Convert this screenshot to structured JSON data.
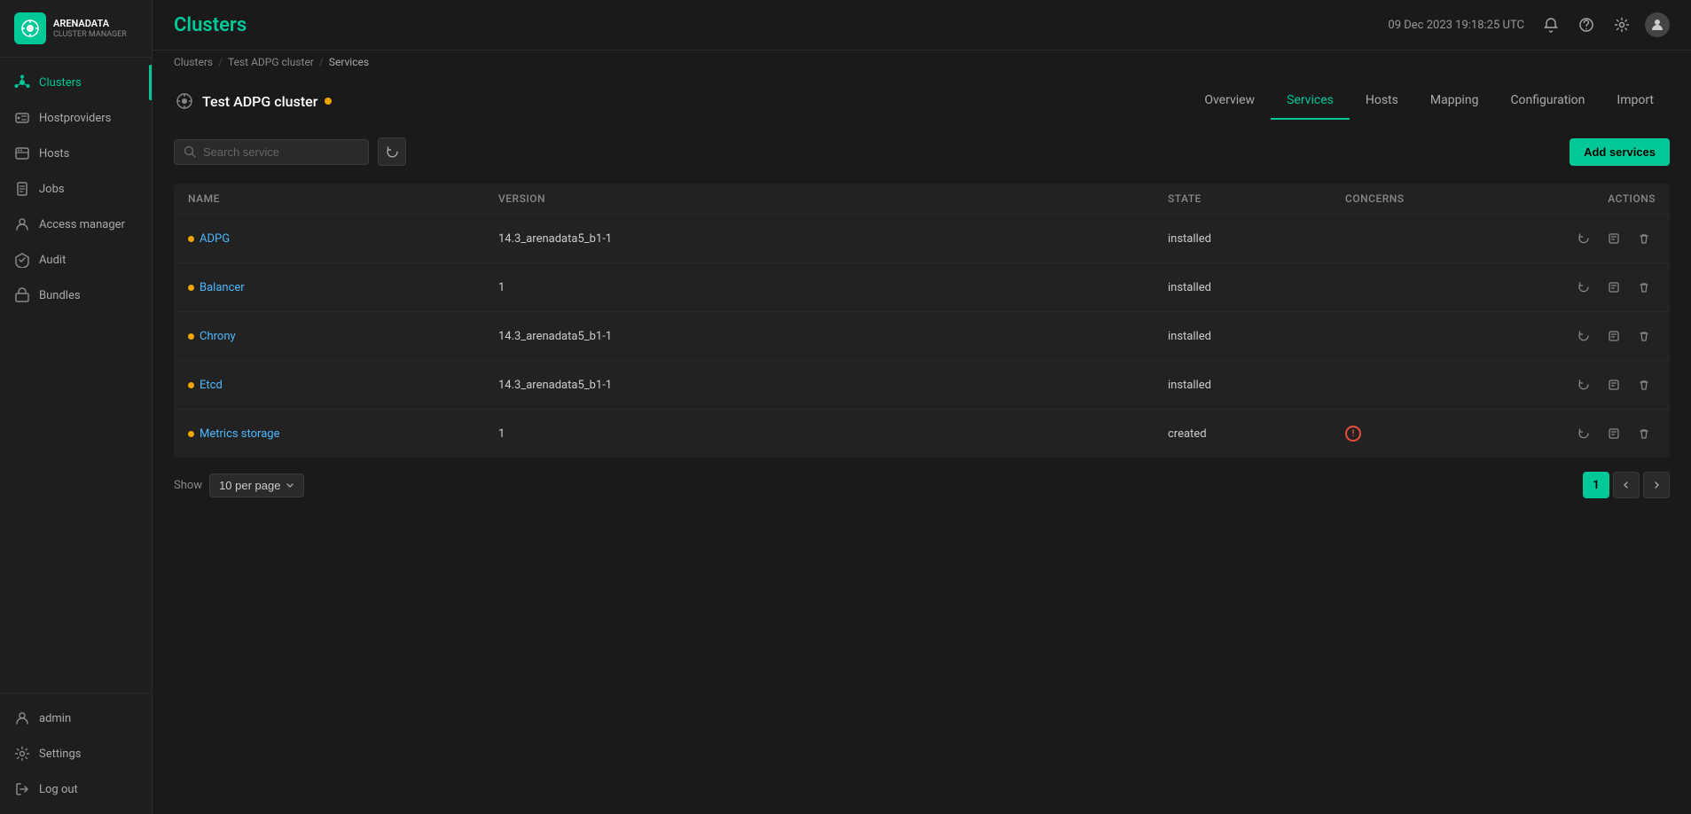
{
  "app": {
    "logo_text": "ARENADATA",
    "logo_sub": "CLUSTER MANAGER"
  },
  "sidebar": {
    "nav_items": [
      {
        "id": "clusters",
        "label": "Clusters",
        "active": true
      },
      {
        "id": "hostproviders",
        "label": "Hostproviders",
        "active": false
      },
      {
        "id": "hosts",
        "label": "Hosts",
        "active": false
      },
      {
        "id": "jobs",
        "label": "Jobs",
        "active": false
      },
      {
        "id": "access-manager",
        "label": "Access manager",
        "active": false
      },
      {
        "id": "audit",
        "label": "Audit",
        "active": false
      },
      {
        "id": "bundles",
        "label": "Bundles",
        "active": false
      }
    ],
    "bottom_items": [
      {
        "id": "admin",
        "label": "admin"
      },
      {
        "id": "settings",
        "label": "Settings"
      },
      {
        "id": "logout",
        "label": "Log out"
      }
    ]
  },
  "topbar": {
    "title": "Clusters",
    "datetime": "09 Dec 2023  19:18:25  UTC"
  },
  "breadcrumb": {
    "items": [
      "Clusters",
      "Test ADPG cluster",
      "Services"
    ]
  },
  "cluster": {
    "name": "Test ADPG cluster",
    "status": "warning"
  },
  "tabs": [
    {
      "id": "overview",
      "label": "Overview",
      "active": false
    },
    {
      "id": "services",
      "label": "Services",
      "active": true
    },
    {
      "id": "hosts",
      "label": "Hosts",
      "active": false
    },
    {
      "id": "mapping",
      "label": "Mapping",
      "active": false
    },
    {
      "id": "configuration",
      "label": "Configuration",
      "active": false
    },
    {
      "id": "import",
      "label": "Import",
      "active": false
    }
  ],
  "toolbar": {
    "search_placeholder": "Search service",
    "add_button_label": "Add services"
  },
  "table": {
    "columns": [
      "Name",
      "Version",
      "State",
      "Concerns",
      "Actions"
    ],
    "rows": [
      {
        "name": "ADPG",
        "dot_color": "yellow",
        "version": "14.3_arenadata5_b1-1",
        "state": "installed",
        "has_concern": false
      },
      {
        "name": "Balancer",
        "dot_color": "yellow",
        "version": "1",
        "state": "installed",
        "has_concern": false
      },
      {
        "name": "Chrony",
        "dot_color": "yellow",
        "version": "14.3_arenadata5_b1-1",
        "state": "installed",
        "has_concern": false
      },
      {
        "name": "Etcd",
        "dot_color": "yellow",
        "version": "14.3_arenadata5_b1-1",
        "state": "installed",
        "has_concern": false
      },
      {
        "name": "Metrics storage",
        "dot_color": "yellow",
        "version": "1",
        "state": "created",
        "has_concern": true
      }
    ]
  },
  "pagination": {
    "show_label": "Show",
    "per_page": "10 per page",
    "current_page": "1"
  }
}
